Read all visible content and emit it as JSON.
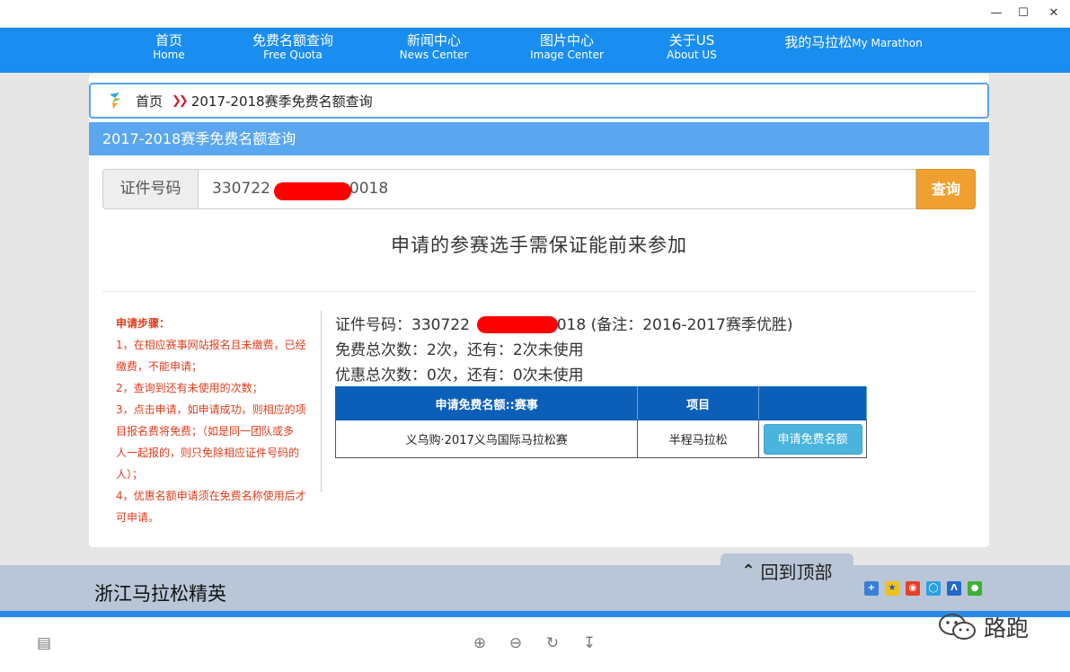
{
  "window": {
    "minimize_icon": "minimize-icon",
    "maximize_icon": "maximize-icon",
    "close_icon": "close-icon"
  },
  "nav": {
    "items": [
      {
        "zh": "首页",
        "en": "Home"
      },
      {
        "zh": "免费名额查询",
        "en": "Free Quota"
      },
      {
        "zh": "新闻中心",
        "en": "News Center"
      },
      {
        "zh": "图片中心",
        "en": "Image Center"
      },
      {
        "zh": "关于US",
        "en": "About US"
      }
    ],
    "mine": {
      "zh": "我的马拉松",
      "en": "My Marathon"
    }
  },
  "breadcrumb": {
    "home": "首页",
    "current": "2017-2018赛季免费名额查询"
  },
  "section_title": "2017-2018赛季免费名额查询",
  "search": {
    "label": "证件号码",
    "value_prefix": "330722",
    "value_suffix": "0018",
    "button": "查询"
  },
  "notice": "申请的参赛选手需保证能前来参加",
  "steps": {
    "title": "申请步骤：",
    "lines": [
      "1，在相应赛事网站报名且未缴费，已经",
      "缴费，不能申请；",
      "2，查询到还有未使用的次数；",
      "3，点击申请，如申请成功，则相应的项",
      "目报名费将免费；（如是同一团队或多",
      "人一起报的，则只免除相应证件号码的",
      "人）；",
      "4，优惠名额申请须在免费名称使用后才",
      "可申请。"
    ]
  },
  "info": {
    "id_prefix": "证件号码：330722",
    "id_suffix": "0018 (备注：2016-2017赛季优胜)",
    "free": "免费总次数：2次，还有：2次未使用",
    "discount": "优惠总次数：0次，还有：0次未使用"
  },
  "table": {
    "headers": [
      "申请免费名额::赛事",
      "项目",
      ""
    ],
    "rows": [
      {
        "event": "义乌购·2017义乌国际马拉松赛",
        "item": "半程马拉松",
        "action": "申请免费名额"
      }
    ]
  },
  "footer": {
    "title": "浙江马拉松精英",
    "back_to_top": "回到顶部"
  },
  "watermark": "路跑",
  "colors": {
    "nav": "#1a8df0",
    "section": "#5aa7f0",
    "table_head": "#0c5fb8",
    "search_button": "#f0a030",
    "apply_button": "#4bb4dc",
    "steps_text": "#e03c1c"
  }
}
